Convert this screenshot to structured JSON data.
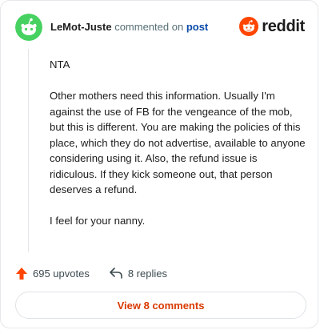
{
  "comment": {
    "author": "LeMot-Juste",
    "action_text": "commented on",
    "post_link": "post",
    "paragraphs": [
      "NTA",
      "Other mothers need this information. Usually I'm against the use of FB for the vengeance of the mob, but this is different. You are making the policies of this place, which they do not advertise, available to anyone considering using it. Also, the refund issue is ridiculous. If they kick someone out, that person deserves a refund.",
      "I feel for your nanny."
    ]
  },
  "brand": {
    "wordmark": "reddit",
    "icon": "reddit-logo-icon"
  },
  "footer": {
    "upvotes_label": "695 upvotes",
    "replies_label": "8 replies",
    "upvote_icon": "upvote-arrow-icon",
    "reply_icon": "reply-arrow-icon"
  },
  "view_button": {
    "label": "View 8 comments"
  },
  "colors": {
    "avatar": "#46d160",
    "brand_orange": "#ff4500",
    "link_blue": "#0a4aa8",
    "button_text": "#d93900"
  }
}
